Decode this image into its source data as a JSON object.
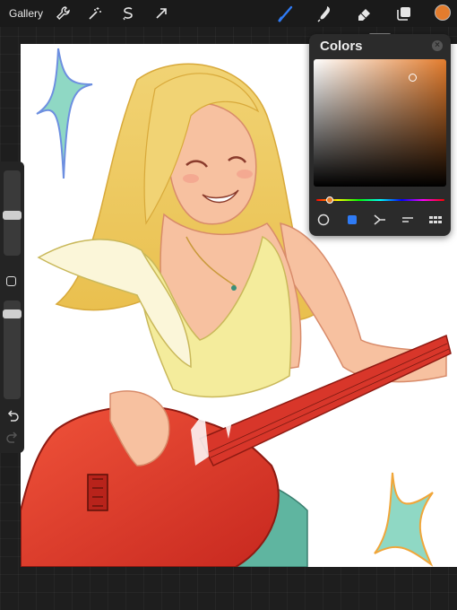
{
  "topbar": {
    "gallery_label": "Gallery",
    "tools_left": [
      "wrench-icon",
      "magic-wand-icon",
      "selection-icon",
      "transform-arrow-icon"
    ],
    "tools_right": [
      "brush-icon",
      "smudge-icon",
      "eraser-icon",
      "layers-icon"
    ],
    "active_tool": "brush-icon",
    "active_color": "#e37c2d",
    "accent_color": "#2f7bf5"
  },
  "colors_panel": {
    "title": "Colors",
    "close_label": "×",
    "current_hue_color": "#e37c2d",
    "modes": [
      "disc-icon",
      "classic-icon",
      "harmony-icon",
      "value-icon",
      "palettes-icon"
    ],
    "active_mode": "classic-icon"
  },
  "sidebar": {
    "brush_size": 0.5,
    "opacity": 0.4,
    "undo_icon": "undo-icon",
    "redo_icon": "redo-icon"
  }
}
